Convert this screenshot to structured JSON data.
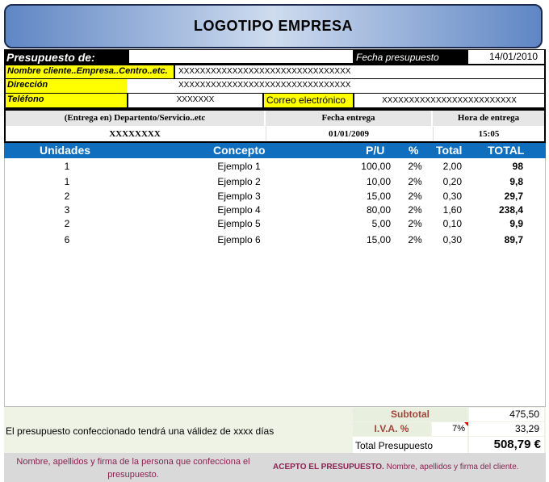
{
  "banner": {
    "title": "LOGOTIPO EMPRESA"
  },
  "header": {
    "presupuesto_label": "Presupuesto de:",
    "fecha_label": "Fecha presupuesto",
    "fecha_value": "14/01/2010",
    "cliente_label": "Nombre cliente..Empresa..Centro..etc.",
    "cliente_value": "XXXXXXXXXXXXXXXXXXXXXXXXXXXXXXXX",
    "direccion_label": "Dirección",
    "direccion_value": "XXXXXXXXXXXXXXXXXXXXXXXXXXXXXXXX",
    "telefono_label": "Teléfono",
    "telefono_value": "XXXXXXX",
    "correo_label": "Correo electrónico",
    "correo_value": "XXXXXXXXXXXXXXXXXXXXXXXXX"
  },
  "delivery": {
    "entrega_label": "(Entrega en) Departento/Servicio..etc",
    "entrega_value": "XXXXXXXX",
    "fecha_label": "Fecha entrega",
    "fecha_value": "01/01/2009",
    "hora_label": "Hora de entrega",
    "hora_value": "15:05"
  },
  "table": {
    "headers": {
      "unidades": "Unidades",
      "concepto": "Concepto",
      "pu": "P/U",
      "pct": "%",
      "total": "Total",
      "total2": "TOTAL"
    },
    "rows": [
      {
        "unidades": "1",
        "concepto": "Ejemplo 1",
        "pu": "100,00",
        "pct": "2%",
        "total": "2,00",
        "total2": "98"
      },
      {
        "unidades": "1",
        "concepto": "Ejemplo 2",
        "pu": "10,00",
        "pct": "2%",
        "total": "0,20",
        "total2": "9,8"
      },
      {
        "unidades": "2",
        "concepto": "Ejemplo 3",
        "pu": "15,00",
        "pct": "2%",
        "total": "0,30",
        "total2": "29,7"
      },
      {
        "unidades": "3",
        "concepto": "Ejemplo 4",
        "pu": "80,00",
        "pct": "2%",
        "total": "1,60",
        "total2": "238,4"
      },
      {
        "unidades": "2",
        "concepto": "Ejemplo 5",
        "pu": "5,00",
        "pct": "2%",
        "total": "0,10",
        "total2": "9,9"
      },
      {
        "unidades": "6",
        "concepto": "Ejemplo 6",
        "pu": "15,00",
        "pct": "2%",
        "total": "0,30",
        "total2": "89,7"
      }
    ]
  },
  "footer": {
    "validez": "El presupuesto confeccionado tendrá una válidez de xxxx días",
    "subtotal_label": "Subtotal",
    "subtotal_value": "475,50",
    "iva_label": "I.V.A. %",
    "iva_pct": "7%",
    "iva_value": "33,29",
    "total_label": "Total Presupuesto",
    "total_value": "508,79 €"
  },
  "signatures": {
    "left": "Nombre, apellidos y firma de la persona que confecciona el presupuesto.",
    "right_bold": "ACEPTO EL PRESUPUESTO.",
    "right_rest": " Nombre, apellidos y firma del cliente."
  },
  "colors": {
    "header_blue": "#0f6fbe",
    "highlight": "#ffff00",
    "maroon": "#8b2252"
  }
}
